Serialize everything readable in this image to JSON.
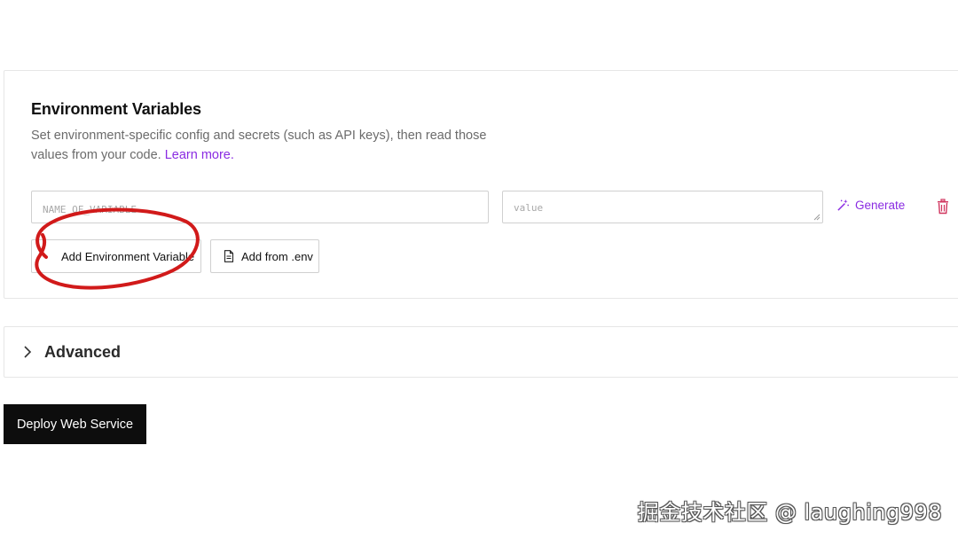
{
  "env_section": {
    "title": "Environment Variables",
    "description": "Set environment-specific config and secrets (such as API keys), then read those values from your code.",
    "learn_more": "Learn more.",
    "key_placeholder": "NAME_OF_VARIABLE",
    "value_placeholder": "value",
    "generate_label": "Generate",
    "add_variable_label": "Add Environment Variable",
    "add_from_env_label": "Add from .env"
  },
  "advanced": {
    "label": "Advanced"
  },
  "deploy": {
    "label": "Deploy Web Service"
  },
  "watermark": {
    "text": "掘金技术社区 @ laughing998"
  },
  "colors": {
    "accent": "#8a2be2",
    "delete": "#d0345e",
    "annotation": "#d11a1a",
    "deploy_bg": "#0d0d0d"
  },
  "icons": {
    "generate": "magic-wand-icon",
    "delete": "trash-icon",
    "add_from_env": "file-icon",
    "advanced_toggle": "chevron-right-icon"
  }
}
